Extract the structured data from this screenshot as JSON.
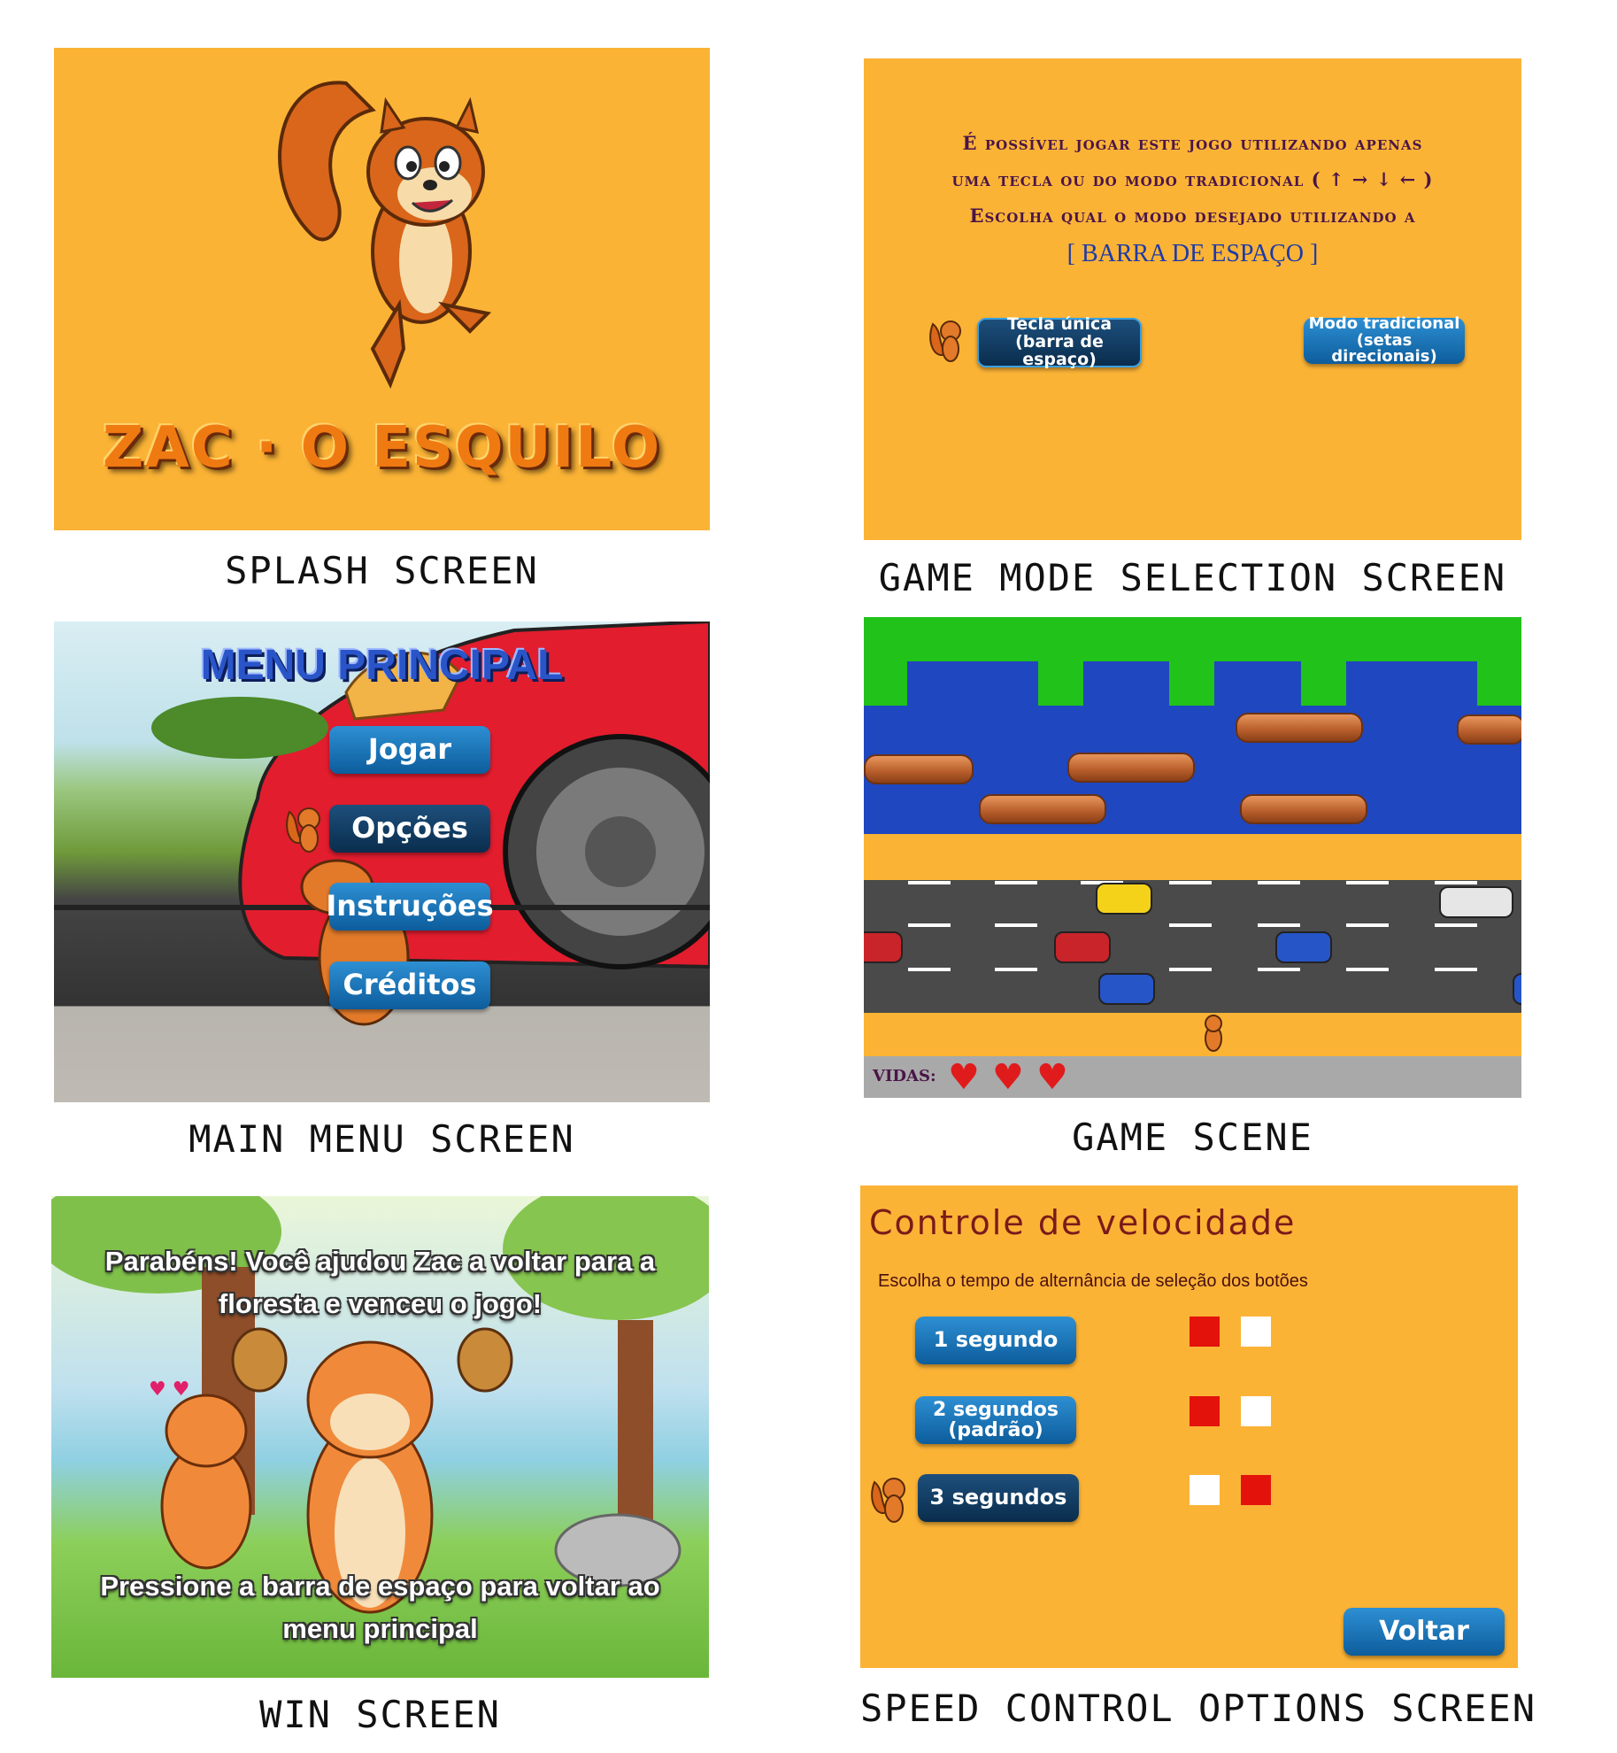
{
  "captions": {
    "splash": "SPLASH SCREEN",
    "mode": "GAME MODE SELECTION SCREEN",
    "menu": "MAIN MENU SCREEN",
    "game": "GAME SCENE",
    "win": "WIN SCREEN",
    "speed": "SPEED CONTROL OPTIONS SCREEN"
  },
  "splash": {
    "logo_text": "ZAC · O ESQUILO"
  },
  "mode_select": {
    "line1": "É possível jogar este jogo utilizando apenas",
    "line2": "uma tecla ou do modo tradicional ( ↑ → ↓ ← )",
    "line3": "Escolha qual o modo desejado utilizando a",
    "line4": "[ BARRA DE ESPAÇO ]",
    "btn_single_1": "Tecla única",
    "btn_single_2": "(barra de espaço)",
    "btn_trad_1": "Modo tradicional",
    "btn_trad_2": "(setas direcionais)"
  },
  "main_menu": {
    "title": "MENU PRINCIPAL",
    "items": [
      "Jogar",
      "Opções",
      "Instruções",
      "Créditos"
    ]
  },
  "game_scene": {
    "lives_label": "VIDAS:",
    "lives": 3
  },
  "win": {
    "message": "Parabéns! Você ajudou Zac a voltar para a floresta e venceu o jogo!",
    "prompt": "Pressione a barra de espaço para voltar ao menu principal"
  },
  "speed_control": {
    "title": "Controle de velocidade",
    "subtitle": "Escolha o tempo de alternância de seleção dos botões",
    "options": [
      "1 segundo",
      "2 segundos (padrão)",
      "3 segundos"
    ],
    "back": "Voltar",
    "colors": {
      "red": "#e3120b",
      "white": "#ffffff"
    }
  },
  "colors": {
    "orange_bg": "#fbb336",
    "button_blue": "#1a73b8",
    "grass": "#21c21a",
    "water": "#1f47c0",
    "road": "#4a4a4a"
  }
}
